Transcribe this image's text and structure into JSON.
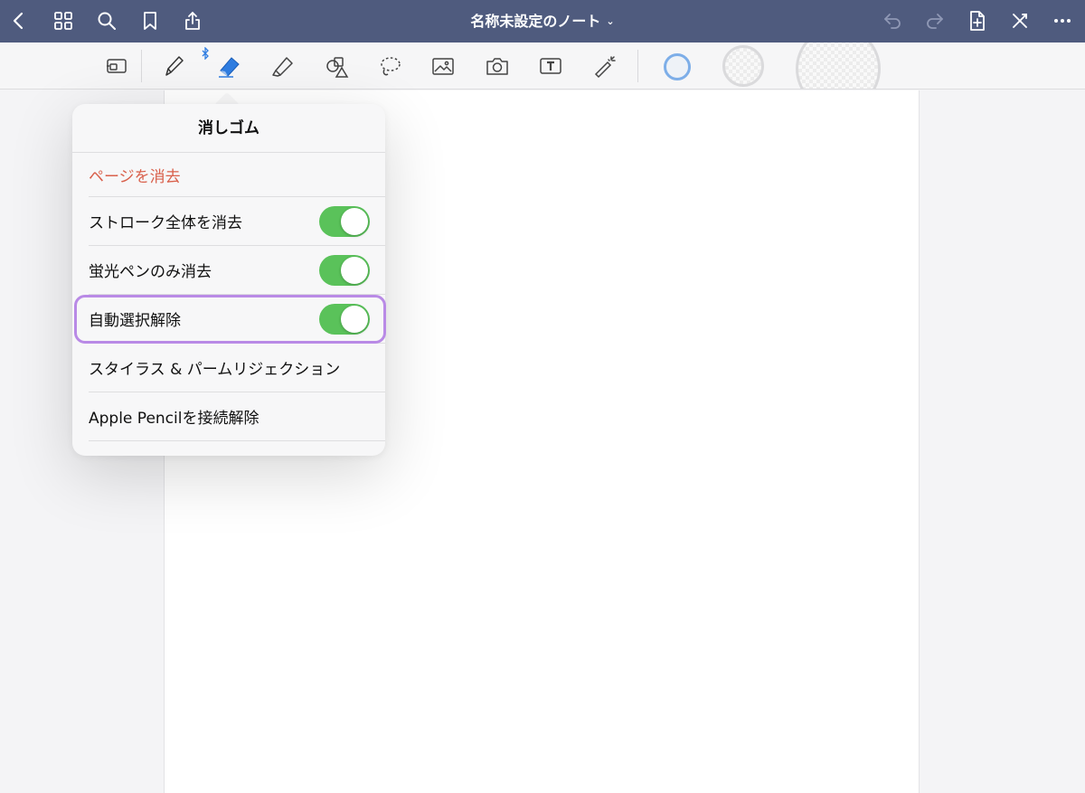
{
  "topbar": {
    "title": "名称未設定のノート",
    "title_chevron": "⌄",
    "bg_color": "#4f5b7e",
    "left_icons": [
      "back-chevron-icon",
      "grid-icon",
      "search-icon",
      "bookmark-icon",
      "share-icon"
    ],
    "right_icons": [
      "undo-icon",
      "redo-icon",
      "add-page-icon",
      "close-pen-icon",
      "more-icon"
    ]
  },
  "toolbar": {
    "tools": [
      "zoom-window-icon",
      "pen-icon",
      "eraser-icon",
      "highlighter-icon",
      "shapes-icon",
      "lasso-icon",
      "image-icon",
      "camera-icon",
      "text-icon",
      "laser-pointer-icon"
    ],
    "selected_tool": "eraser-icon",
    "accent_color": "#2f7de1",
    "size_options": [
      "small",
      "medium",
      "large"
    ]
  },
  "popover": {
    "title": "消しゴム",
    "clear_page": "ページを消去",
    "rows": [
      {
        "label": "ストローク全体を消去",
        "toggle": true
      },
      {
        "label": "蛍光ペンのみ消去",
        "toggle": true
      },
      {
        "label": "自動選択解除",
        "toggle": true,
        "highlighted": true
      },
      {
        "label": "スタイラス & パームリジェクション"
      },
      {
        "label": "Apple Pencilを接続解除"
      }
    ],
    "toggle_color": "#5ac25a",
    "danger_color": "#d9604b",
    "highlight_color": "#b98ae6"
  }
}
